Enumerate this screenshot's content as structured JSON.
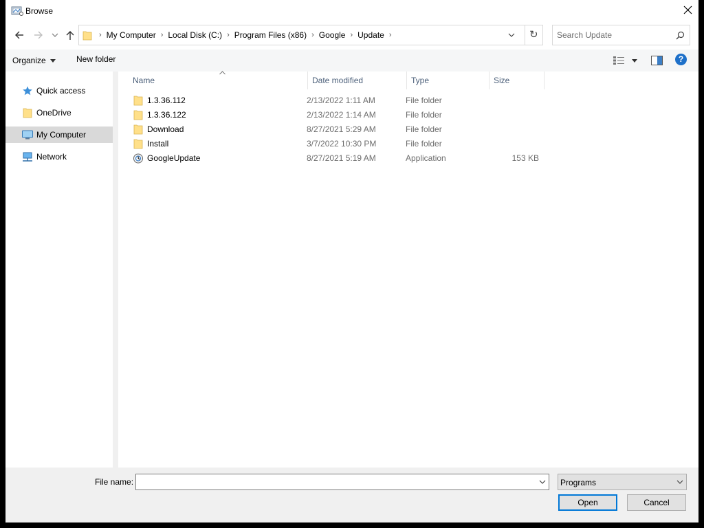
{
  "window": {
    "title": "Browse"
  },
  "address_bar": {
    "crumbs": [
      "My Computer",
      "Local Disk (C:)",
      "Program Files (x86)",
      "Google",
      "Update"
    ]
  },
  "search": {
    "placeholder": "Search Update",
    "value": ""
  },
  "toolbar": {
    "organize_label": "Organize",
    "new_folder_label": "New folder",
    "help_label": "?"
  },
  "nav_pane": {
    "items": [
      {
        "label": "Quick access",
        "icon": "star-icon",
        "selected": false
      },
      {
        "label": "OneDrive",
        "icon": "folder-icon",
        "selected": false
      },
      {
        "label": "My Computer",
        "icon": "computer-icon",
        "selected": true
      },
      {
        "label": "Network",
        "icon": "network-icon",
        "selected": false
      }
    ]
  },
  "file_list": {
    "columns": [
      "Name",
      "Date modified",
      "Type",
      "Size"
    ],
    "sort_column": "Name",
    "sort_direction": "ascending",
    "rows": [
      {
        "name": "1.3.36.112",
        "date": "2/13/2022 1:11 AM",
        "type": "File folder",
        "size": "",
        "icon": "folder-icon"
      },
      {
        "name": "1.3.36.122",
        "date": "2/13/2022 1:14 AM",
        "type": "File folder",
        "size": "",
        "icon": "folder-icon"
      },
      {
        "name": "Download",
        "date": "8/27/2021 5:29 AM",
        "type": "File folder",
        "size": "",
        "icon": "folder-icon"
      },
      {
        "name": "Install",
        "date": "3/7/2022 10:30 PM",
        "type": "File folder",
        "size": "",
        "icon": "folder-icon"
      },
      {
        "name": "GoogleUpdate",
        "date": "8/27/2021 5:19 AM",
        "type": "Application",
        "size": "153 KB",
        "icon": "application-icon"
      }
    ]
  },
  "footer": {
    "file_name_label": "File name:",
    "file_name_value": "",
    "file_type_selected": "Programs",
    "open_label": "Open",
    "cancel_label": "Cancel"
  },
  "colors": {
    "folder": "#ffe08a",
    "selection": "#d9d9d9",
    "accent": "#0078d7",
    "help": "#1e70c9",
    "header_text": "#4c607a"
  }
}
